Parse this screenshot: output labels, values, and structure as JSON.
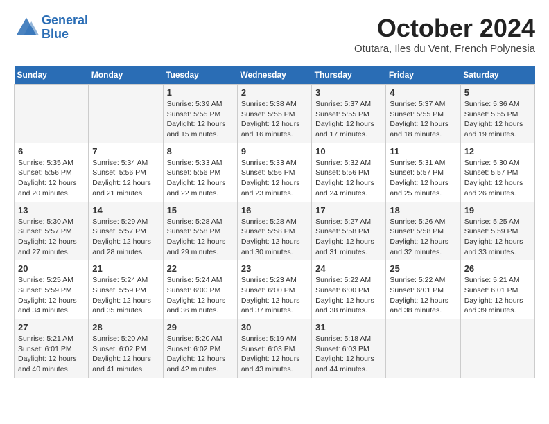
{
  "header": {
    "logo_line1": "General",
    "logo_line2": "Blue",
    "month": "October 2024",
    "location": "Otutara, Iles du Vent, French Polynesia"
  },
  "days_of_week": [
    "Sunday",
    "Monday",
    "Tuesday",
    "Wednesday",
    "Thursday",
    "Friday",
    "Saturday"
  ],
  "weeks": [
    [
      {
        "day": "",
        "info": ""
      },
      {
        "day": "",
        "info": ""
      },
      {
        "day": "1",
        "info": "Sunrise: 5:39 AM\nSunset: 5:55 PM\nDaylight: 12 hours and 15 minutes."
      },
      {
        "day": "2",
        "info": "Sunrise: 5:38 AM\nSunset: 5:55 PM\nDaylight: 12 hours and 16 minutes."
      },
      {
        "day": "3",
        "info": "Sunrise: 5:37 AM\nSunset: 5:55 PM\nDaylight: 12 hours and 17 minutes."
      },
      {
        "day": "4",
        "info": "Sunrise: 5:37 AM\nSunset: 5:55 PM\nDaylight: 12 hours and 18 minutes."
      },
      {
        "day": "5",
        "info": "Sunrise: 5:36 AM\nSunset: 5:55 PM\nDaylight: 12 hours and 19 minutes."
      }
    ],
    [
      {
        "day": "6",
        "info": "Sunrise: 5:35 AM\nSunset: 5:56 PM\nDaylight: 12 hours and 20 minutes."
      },
      {
        "day": "7",
        "info": "Sunrise: 5:34 AM\nSunset: 5:56 PM\nDaylight: 12 hours and 21 minutes."
      },
      {
        "day": "8",
        "info": "Sunrise: 5:33 AM\nSunset: 5:56 PM\nDaylight: 12 hours and 22 minutes."
      },
      {
        "day": "9",
        "info": "Sunrise: 5:33 AM\nSunset: 5:56 PM\nDaylight: 12 hours and 23 minutes."
      },
      {
        "day": "10",
        "info": "Sunrise: 5:32 AM\nSunset: 5:56 PM\nDaylight: 12 hours and 24 minutes."
      },
      {
        "day": "11",
        "info": "Sunrise: 5:31 AM\nSunset: 5:57 PM\nDaylight: 12 hours and 25 minutes."
      },
      {
        "day": "12",
        "info": "Sunrise: 5:30 AM\nSunset: 5:57 PM\nDaylight: 12 hours and 26 minutes."
      }
    ],
    [
      {
        "day": "13",
        "info": "Sunrise: 5:30 AM\nSunset: 5:57 PM\nDaylight: 12 hours and 27 minutes."
      },
      {
        "day": "14",
        "info": "Sunrise: 5:29 AM\nSunset: 5:57 PM\nDaylight: 12 hours and 28 minutes."
      },
      {
        "day": "15",
        "info": "Sunrise: 5:28 AM\nSunset: 5:58 PM\nDaylight: 12 hours and 29 minutes."
      },
      {
        "day": "16",
        "info": "Sunrise: 5:28 AM\nSunset: 5:58 PM\nDaylight: 12 hours and 30 minutes."
      },
      {
        "day": "17",
        "info": "Sunrise: 5:27 AM\nSunset: 5:58 PM\nDaylight: 12 hours and 31 minutes."
      },
      {
        "day": "18",
        "info": "Sunrise: 5:26 AM\nSunset: 5:58 PM\nDaylight: 12 hours and 32 minutes."
      },
      {
        "day": "19",
        "info": "Sunrise: 5:25 AM\nSunset: 5:59 PM\nDaylight: 12 hours and 33 minutes."
      }
    ],
    [
      {
        "day": "20",
        "info": "Sunrise: 5:25 AM\nSunset: 5:59 PM\nDaylight: 12 hours and 34 minutes."
      },
      {
        "day": "21",
        "info": "Sunrise: 5:24 AM\nSunset: 5:59 PM\nDaylight: 12 hours and 35 minutes."
      },
      {
        "day": "22",
        "info": "Sunrise: 5:24 AM\nSunset: 6:00 PM\nDaylight: 12 hours and 36 minutes."
      },
      {
        "day": "23",
        "info": "Sunrise: 5:23 AM\nSunset: 6:00 PM\nDaylight: 12 hours and 37 minutes."
      },
      {
        "day": "24",
        "info": "Sunrise: 5:22 AM\nSunset: 6:00 PM\nDaylight: 12 hours and 38 minutes."
      },
      {
        "day": "25",
        "info": "Sunrise: 5:22 AM\nSunset: 6:01 PM\nDaylight: 12 hours and 38 minutes."
      },
      {
        "day": "26",
        "info": "Sunrise: 5:21 AM\nSunset: 6:01 PM\nDaylight: 12 hours and 39 minutes."
      }
    ],
    [
      {
        "day": "27",
        "info": "Sunrise: 5:21 AM\nSunset: 6:01 PM\nDaylight: 12 hours and 40 minutes."
      },
      {
        "day": "28",
        "info": "Sunrise: 5:20 AM\nSunset: 6:02 PM\nDaylight: 12 hours and 41 minutes."
      },
      {
        "day": "29",
        "info": "Sunrise: 5:20 AM\nSunset: 6:02 PM\nDaylight: 12 hours and 42 minutes."
      },
      {
        "day": "30",
        "info": "Sunrise: 5:19 AM\nSunset: 6:03 PM\nDaylight: 12 hours and 43 minutes."
      },
      {
        "day": "31",
        "info": "Sunrise: 5:18 AM\nSunset: 6:03 PM\nDaylight: 12 hours and 44 minutes."
      },
      {
        "day": "",
        "info": ""
      },
      {
        "day": "",
        "info": ""
      }
    ]
  ]
}
